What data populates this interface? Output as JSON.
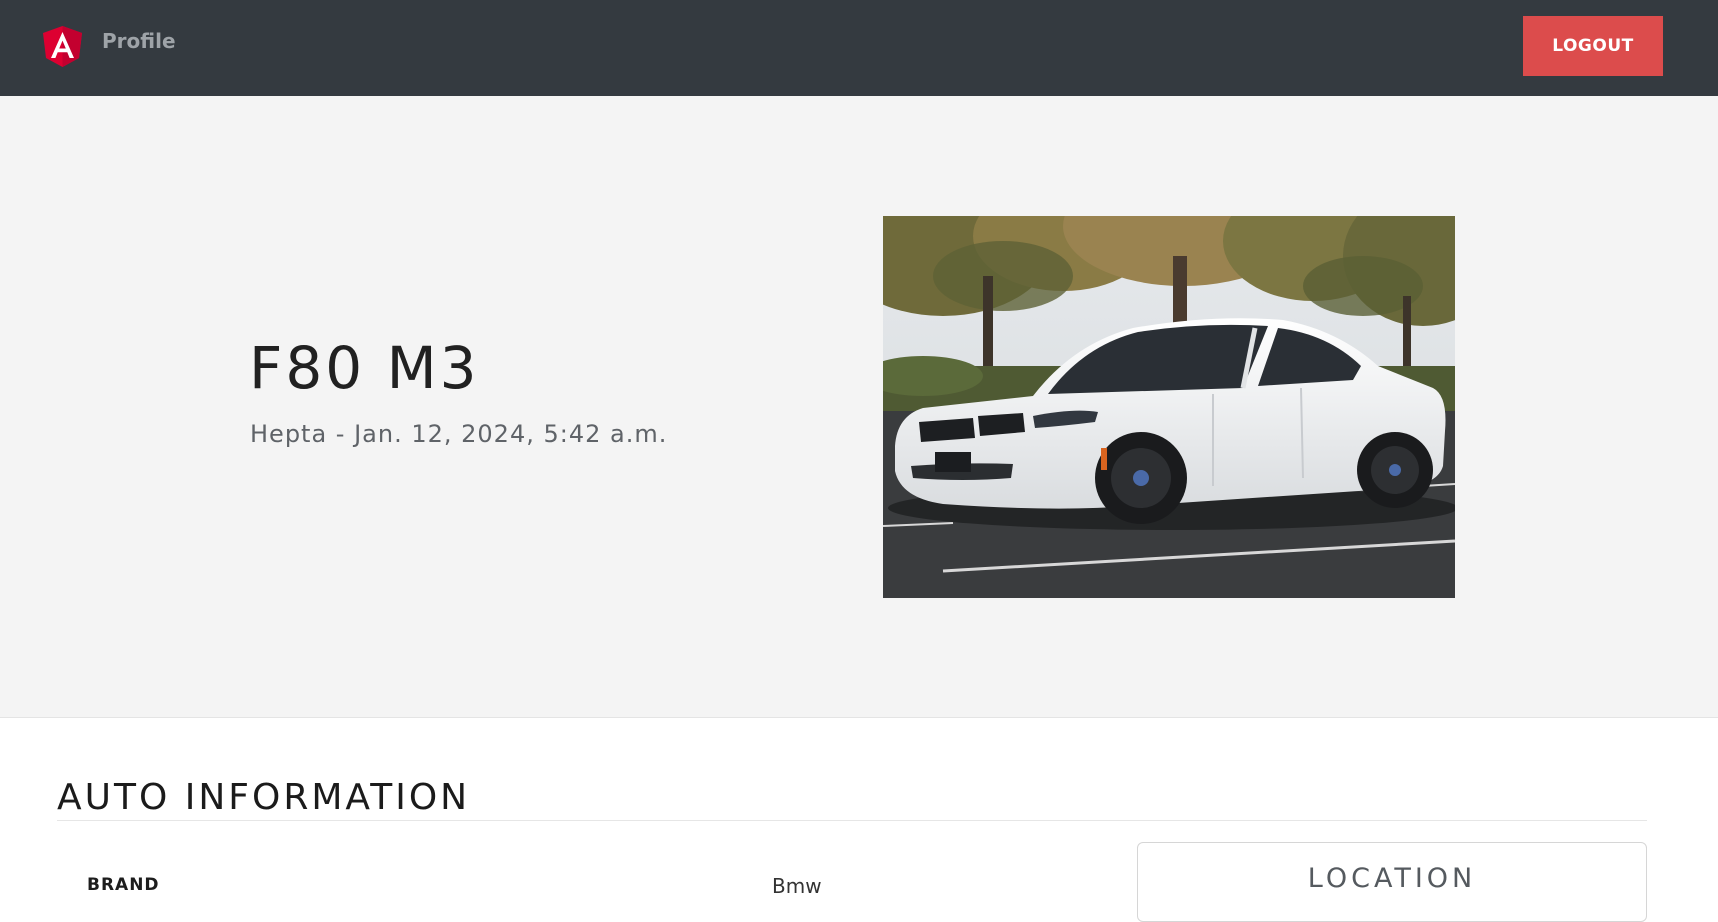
{
  "navbar": {
    "brand_label": "Profile",
    "logo_icon": "angular-logo-icon",
    "logout_label": "LOGOUT",
    "logout_color": "#dc4c4c",
    "background": "#343a40"
  },
  "hero": {
    "title": "F80 M3",
    "subtitle": "Hepta - Jan. 12, 2024, 5:42 a.m.",
    "image_icon": "white-bmw-sedan-photo"
  },
  "auto_information": {
    "heading": "AUTO INFORMATION",
    "rows": [
      {
        "label": "BRAND",
        "value": "Bmw"
      }
    ]
  },
  "location": {
    "heading": "LOCATION"
  }
}
